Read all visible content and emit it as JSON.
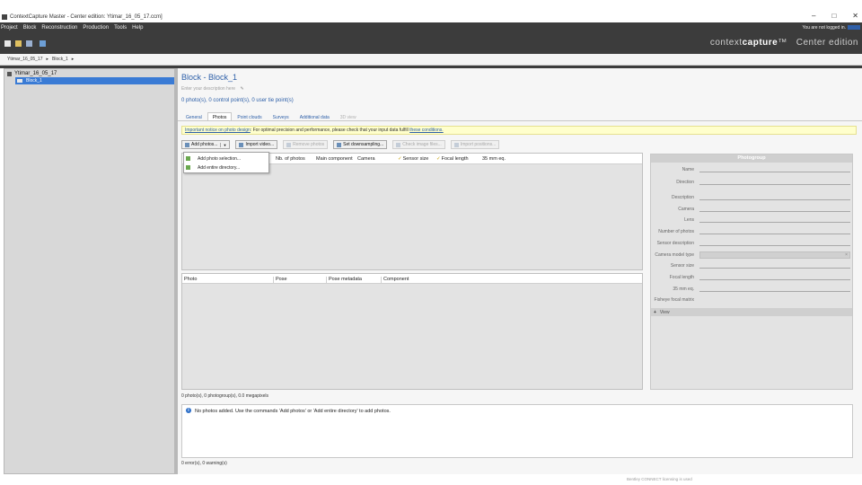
{
  "window": {
    "title": "ContextCapture Master - Center edition: Ytimar_16_05_17.ccm]",
    "controls": [
      "–",
      "□",
      "✕"
    ]
  },
  "menu": {
    "items": [
      "Project",
      "Block",
      "Reconstruction",
      "Production",
      "Tools",
      "Help"
    ],
    "login_text": "You are not logged in."
  },
  "brand": {
    "prefix": "context",
    "accent": "capture",
    "tm": "™",
    "edition": "Center edition"
  },
  "breadcrumb": {
    "items": [
      "Ytimar_16_05_17",
      "Block_1"
    ]
  },
  "tree": {
    "project": "Ytimar_16_05_17",
    "block": "Block_1"
  },
  "block": {
    "title": "Block - Block_1",
    "description_placeholder": "Enter your description here",
    "summary": "0 photo(s), 0 control point(s), 0 user tie point(s)"
  },
  "tabs": [
    "General",
    "Photos",
    "Point clouds",
    "Surveys",
    "Additional data",
    "3D view"
  ],
  "notice": {
    "link": "Important notice on photo design",
    "text": ": For optimal precision and performance, please check that your input data fulfill",
    "link2": "these conditions."
  },
  "actions": {
    "add_photos": "Add photos...",
    "import_video": "Import video...",
    "remove_photos": "Remove photos",
    "set_downsampling": "Set downsampling...",
    "check_image_files": "Check image files...",
    "import_positions": "Import positions..."
  },
  "add_menu": {
    "item1": "Add photo selection...",
    "item2": "Add entire directory..."
  },
  "photogroup_table": {
    "columns": [
      "Nb. of photos",
      "Main component",
      "Camera",
      "Sensor size",
      "Focal length",
      "35 mm eq."
    ]
  },
  "photo_table": {
    "columns": [
      "Photo",
      "Pose",
      "Pose metadata",
      "Component"
    ]
  },
  "props": {
    "title": "Photogroup",
    "rows": [
      {
        "label": "Name"
      },
      {
        "label": "Direction"
      },
      {
        "label": "Description"
      },
      {
        "label": "Camera"
      },
      {
        "label": "Lens"
      },
      {
        "label": "Number of photos"
      },
      {
        "label": "Sensor description"
      },
      {
        "label": "Camera model type",
        "value": "×"
      },
      {
        "label": "Sensor size"
      },
      {
        "label": "Focal length"
      },
      {
        "label": "35 mm eq."
      },
      {
        "label": "Fisheye focal matrix"
      }
    ],
    "footer": "View",
    "footer_icon": "+"
  },
  "photo_count": "0 photo(s), 0 photogroup(s), 0.0 megapixels",
  "info_message": "No photos added. Use the commands 'Add photos' or 'Add entire directory' to add photos.",
  "status": "0 error(s), 0 warning(s)",
  "licence": "Bentley CONNECT licensing is used"
}
